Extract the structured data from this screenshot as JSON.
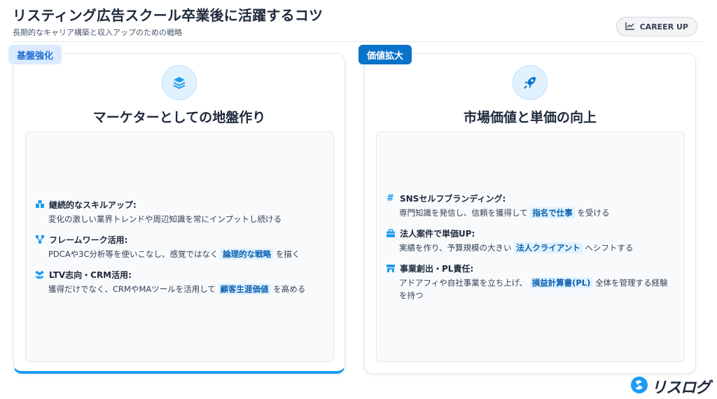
{
  "header": {
    "title": "リスティング広告スクール卒業後に活躍するコツ",
    "subtitle": "長期的なキャリア構築と収入アップのための戦略",
    "badge_label": "CAREER UP",
    "badge_icon": "trend-chart-icon"
  },
  "colors": {
    "accent": "#1d9bf0",
    "tag_right_bg": "#0b72c9",
    "tag_left_bg": "#dbeafe",
    "highlight_bg": "#e0f2fe"
  },
  "left_card": {
    "tag": "基盤強化",
    "icon": "layers-icon",
    "title": "マーケターとしての地盤作り",
    "items": [
      {
        "icon": "users-cubes-icon",
        "heading": "継続的なスキルアップ:",
        "desc_before": "変化の激しい業界トレンドや周辺知識を常にインプットし続ける",
        "desc_highlight": "",
        "desc_after": ""
      },
      {
        "icon": "network-icon",
        "heading": "フレームワーク活用:",
        "desc_before": "PDCAや3C分析等を使いこなし、感覚ではなく",
        "desc_highlight": "論理的な戦略",
        "desc_after": "を描く"
      },
      {
        "icon": "people-group-icon",
        "heading": "LTV志向・CRM活用:",
        "desc_before": "獲得だけでなく、CRMやMAツールを活用して",
        "desc_highlight": "顧客生涯価値",
        "desc_after": "を高める"
      }
    ]
  },
  "right_card": {
    "tag": "価値拡大",
    "icon": "rocket-icon",
    "title": "市場価値と単価の向上",
    "items": [
      {
        "icon": "hashtag-icon",
        "heading": "SNSセルフブランディング:",
        "desc_before": "専門知識を発信し、信頼を獲得して",
        "desc_highlight": "指名で仕事",
        "desc_after": "を受ける"
      },
      {
        "icon": "briefcase-icon",
        "heading": "法人案件で単価UP:",
        "desc_before": "実績を作り、予算規模の大きい",
        "desc_highlight": "法人クライアント",
        "desc_after": "へシフトする"
      },
      {
        "icon": "store-icon",
        "heading": "事業創出・PL責任:",
        "desc_before": "アドアフィや自社事業を立ち上げ、",
        "desc_highlight": "損益計算書(PL)",
        "desc_after": "全体を管理する経験を持つ"
      }
    ]
  },
  "logo": {
    "text": "リスログ",
    "icon": "lisulog-logo-icon"
  }
}
